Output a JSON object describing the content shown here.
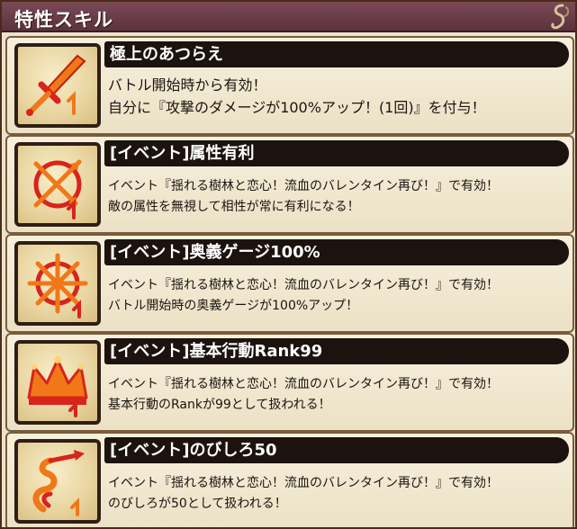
{
  "header": {
    "title": "特性スキル"
  },
  "colors": {
    "header_bg": "#6b3d48",
    "name_bar_bg": "#1c120e",
    "card_bg": "#f3ebd3",
    "icon_orange": "#f07818",
    "icon_red": "#d8241a"
  },
  "skills": [
    {
      "name": "極上のあつらえ",
      "icon": "sword-icon",
      "desc": [
        "バトル開始時から有効！",
        "自分に『攻撃のダメージが100%アップ！(1回)』を付与！"
      ]
    },
    {
      "name": "[イベント]属性有利",
      "icon": "crossed-arrows-icon",
      "desc": [
        "イベント『揺れる樹林と恋心！流血のバレンタイン再び！』で有効！",
        "敵の属性を無視して相性が常に有利になる！"
      ]
    },
    {
      "name": "[イベント]奥義ゲージ100%",
      "icon": "burst-star-icon",
      "desc": [
        "イベント『揺れる樹林と恋心！流血のバレンタイン再び！』で有効！",
        "バトル開始時の奥義ゲージが100%アップ！"
      ]
    },
    {
      "name": "[イベント]基本行動Rank99",
      "icon": "crown-icon",
      "desc": [
        "イベント『揺れる樹林と恋心！流血のバレンタイン再び！』で有効！",
        "基本行動のRankが99として扱われる！"
      ]
    },
    {
      "name": "[イベント]のびしろ50",
      "icon": "spiral-arrow-icon",
      "desc": [
        "イベント『揺れる樹林と恋心！流血のバレンタイン再び！』で有効！",
        "のびしろが50として扱われる！"
      ]
    }
  ]
}
